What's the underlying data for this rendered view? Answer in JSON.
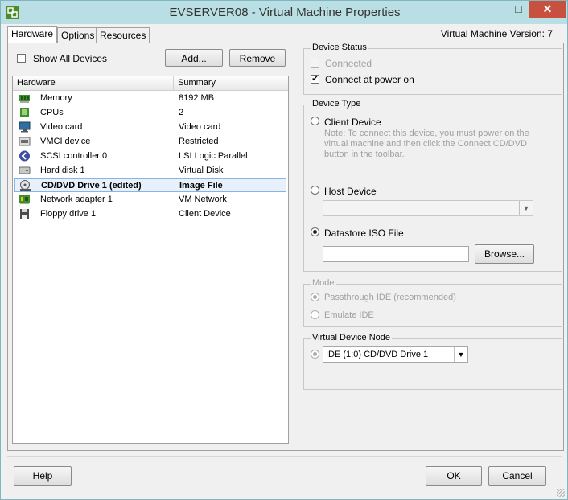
{
  "window": {
    "title": "EVSERVER08 - Virtual Machine Properties",
    "controls": {
      "minimize": "–",
      "maximize": "□",
      "close": "✕"
    }
  },
  "tabs": [
    {
      "label": "Hardware",
      "active": true
    },
    {
      "label": "Options",
      "active": false
    },
    {
      "label": "Resources",
      "active": false
    }
  ],
  "vm_version": "Virtual Machine Version: 7",
  "toolbar": {
    "show_all_devices": "Show All Devices",
    "add_button": "Add...",
    "remove_button": "Remove"
  },
  "hardware_list": {
    "columns": [
      "Hardware",
      "Summary"
    ],
    "rows": [
      {
        "name": "Memory",
        "summary": "8192 MB",
        "icon": "memory-icon",
        "selected": false
      },
      {
        "name": "CPUs",
        "summary": "2",
        "icon": "cpu-icon",
        "selected": false
      },
      {
        "name": "Video card",
        "summary": "Video card",
        "icon": "video-card-icon",
        "selected": false
      },
      {
        "name": "VMCI device",
        "summary": "Restricted",
        "icon": "vmci-device-icon",
        "selected": false
      },
      {
        "name": "SCSI controller 0",
        "summary": "LSI Logic Parallel",
        "icon": "scsi-controller-icon",
        "selected": false
      },
      {
        "name": "Hard disk 1",
        "summary": "Virtual Disk",
        "icon": "hard-disk-icon",
        "selected": false
      },
      {
        "name": "CD/DVD Drive 1 (edited)",
        "summary": "Image File",
        "icon": "cd-dvd-drive-icon",
        "selected": true
      },
      {
        "name": "Network adapter 1",
        "summary": "VM Network",
        "icon": "network-adapter-icon",
        "selected": false
      },
      {
        "name": "Floppy drive 1",
        "summary": "Client Device",
        "icon": "floppy-drive-icon",
        "selected": false
      }
    ]
  },
  "device_status": {
    "title": "Device Status",
    "connected": "Connected",
    "connect_at_power_on": "Connect at power on"
  },
  "device_type": {
    "title": "Device Type",
    "client_device": "Client Device",
    "client_note": "Note: To connect this device, you must power on the virtual machine and then click the Connect CD/DVD button in the toolbar.",
    "host_device": "Host Device",
    "datastore_iso": "Datastore ISO File",
    "iso_path": "",
    "browse_button": "Browse..."
  },
  "mode": {
    "title": "Mode",
    "passthrough": "Passthrough IDE (recommended)",
    "emulate": "Emulate IDE"
  },
  "virtual_device_node": {
    "title": "Virtual Device Node",
    "selected": "IDE (1:0) CD/DVD Drive 1"
  },
  "footer": {
    "help": "Help",
    "ok": "OK",
    "cancel": "Cancel"
  }
}
